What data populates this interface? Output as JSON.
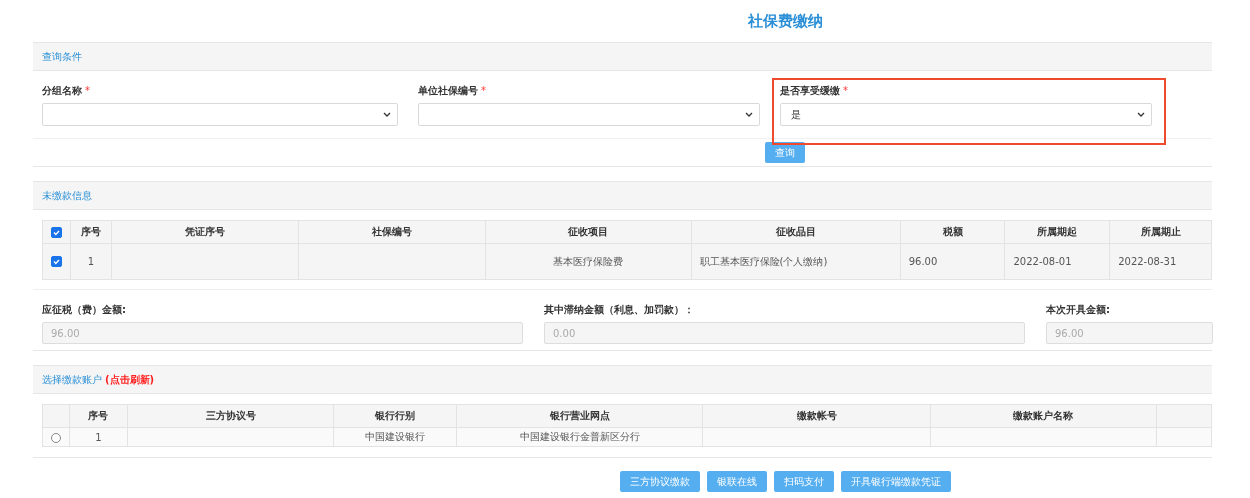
{
  "page_title": "社保费缴纳",
  "query_section": {
    "title": "查询条件",
    "fields": [
      {
        "label": "分组名称",
        "required_mark": "*",
        "highlighted": false
      },
      {
        "label": "单位社保编号",
        "required_mark": "*",
        "highlighted": false
      },
      {
        "label": "是否享受缓缴",
        "required_mark": "*",
        "value": "是",
        "highlighted": true
      }
    ],
    "button": "查询"
  },
  "unpaid_section": {
    "title": "未缴款信息",
    "columns": [
      "序号",
      "凭证序号",
      "社保编号",
      "征收项目",
      "征收品目",
      "税额",
      "所属期起",
      "所属期止"
    ],
    "all_checked": true,
    "rows": [
      {
        "checked": true,
        "cells": [
          "1",
          "",
          "",
          "基本医疗保险费",
          "职工基本医疗保险(个人缴纳)",
          "96.00",
          "2022-08-01",
          "2022-08-31"
        ]
      }
    ]
  },
  "amounts": [
    {
      "label": "应征税（费）金额:",
      "value": "96.00",
      "disabled": true
    },
    {
      "label": "其中滞纳金额（利息、加罚款）：",
      "value": "0.00",
      "disabled": true
    },
    {
      "label": "本次开具金额:",
      "value": "96.00",
      "disabled": true
    }
  ],
  "account_section": {
    "title": "选择缴款账户",
    "refresh_link": "(点击刷新)",
    "columns": [
      "序号",
      "三方协议号",
      "银行行别",
      "银行营业网点",
      "缴款帐号",
      "缴款账户名称",
      ""
    ],
    "rows": [
      {
        "selected": false,
        "cells": [
          "1",
          "",
          "中国建设银行",
          "中国建设银行金普新区分行",
          "",
          "",
          ""
        ]
      }
    ]
  },
  "actions": [
    "三方协议缴款",
    "银联在线",
    "扫码支付",
    "开具银行端缴款凭证"
  ]
}
